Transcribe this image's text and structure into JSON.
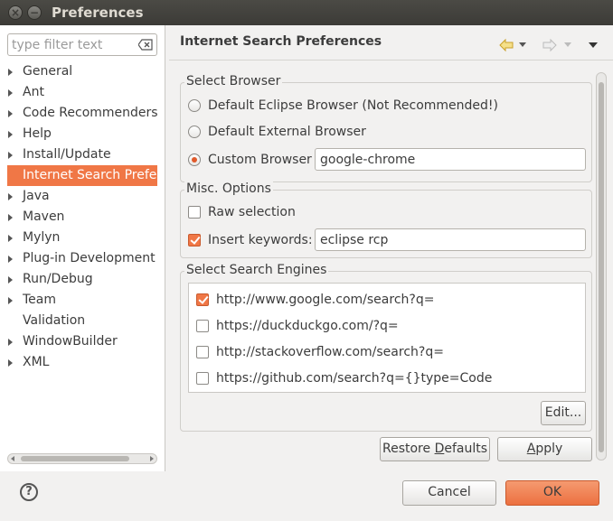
{
  "window": {
    "title": "Preferences"
  },
  "filter": {
    "placeholder": "type filter text"
  },
  "tree": {
    "items": [
      {
        "label": "General",
        "expandable": true
      },
      {
        "label": "Ant",
        "expandable": true
      },
      {
        "label": "Code Recommenders",
        "expandable": true
      },
      {
        "label": "Help",
        "expandable": true
      },
      {
        "label": "Install/Update",
        "expandable": true
      },
      {
        "label": "Internet Search Prefer",
        "expandable": false,
        "selected": true
      },
      {
        "label": "Java",
        "expandable": true
      },
      {
        "label": "Maven",
        "expandable": true
      },
      {
        "label": "Mylyn",
        "expandable": true
      },
      {
        "label": "Plug-in Development",
        "expandable": true
      },
      {
        "label": "Run/Debug",
        "expandable": true
      },
      {
        "label": "Team",
        "expandable": true
      },
      {
        "label": "Validation",
        "expandable": false
      },
      {
        "label": "WindowBuilder",
        "expandable": true
      },
      {
        "label": "XML",
        "expandable": true
      }
    ]
  },
  "page": {
    "title": "Internet Search Preferences",
    "nav_icons": [
      "back-icon",
      "back-menu-icon",
      "forward-icon",
      "forward-menu-icon",
      "view-menu-icon"
    ]
  },
  "select_browser": {
    "label": "Select Browser",
    "options": [
      {
        "label": "Default Eclipse Browser (Not Recommended!)",
        "selected": false
      },
      {
        "label": "Default External Browser",
        "selected": false
      },
      {
        "label": "Custom Browser",
        "selected": true
      }
    ],
    "custom_value": "google-chrome"
  },
  "misc_options": {
    "label": "Misc. Options",
    "raw_selection": {
      "label": "Raw selection",
      "checked": false
    },
    "insert_keywords": {
      "label": "Insert keywords:",
      "checked": true,
      "value": "eclipse rcp"
    }
  },
  "search_engines": {
    "label": "Select Search Engines",
    "items": [
      {
        "url": "http://www.google.com/search?q=",
        "checked": true
      },
      {
        "url": "https://duckduckgo.com/?q=",
        "checked": false
      },
      {
        "url": "http://stackoverflow.com/search?q=",
        "checked": false
      },
      {
        "url": "https://github.com/search?q={}type=Code",
        "checked": false
      }
    ],
    "edit_label": "Edit..."
  },
  "buttons": {
    "restore_defaults_pre": "Restore ",
    "restore_defaults_mnemonic": "D",
    "restore_defaults_post": "efaults",
    "apply_mnemonic": "A",
    "apply_post": "pply",
    "cancel": "Cancel",
    "ok": "OK"
  },
  "colors": {
    "accent": "#f07746",
    "titlebar": "#3c3b37"
  }
}
